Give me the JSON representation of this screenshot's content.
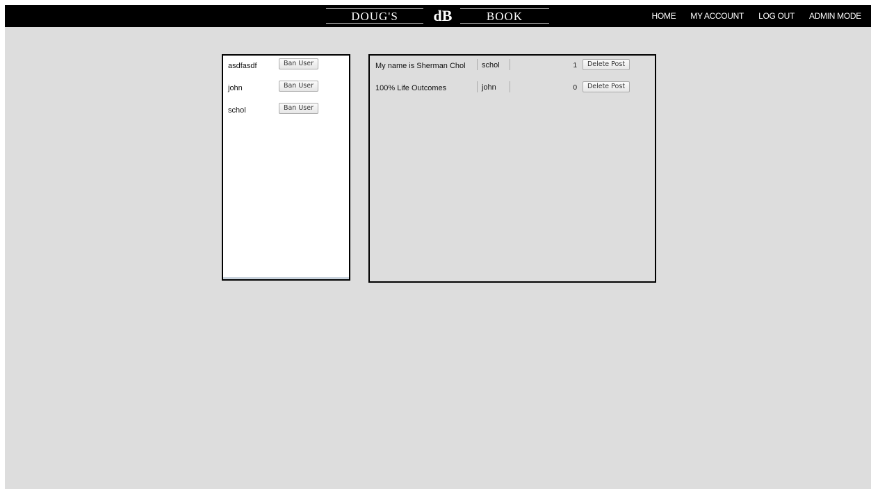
{
  "header": {
    "brand_left": "DOUG'S",
    "brand_logo": "dB",
    "brand_right": "BOOK",
    "nav": [
      {
        "label": "HOME"
      },
      {
        "label": "MY ACCOUNT"
      },
      {
        "label": "LOG OUT"
      },
      {
        "label": "ADMIN MODE"
      }
    ]
  },
  "users": [
    {
      "name": "asdfasdf",
      "action": "Ban User"
    },
    {
      "name": "john",
      "action": "Ban User"
    },
    {
      "name": "schol",
      "action": "Ban User"
    }
  ],
  "posts": [
    {
      "title": "My name is Sherman Chol",
      "author": "schol",
      "count": "1",
      "action": "Delete Post"
    },
    {
      "title": "100% Life Outcomes",
      "author": "john",
      "count": "0",
      "action": "Delete Post"
    }
  ],
  "colors": {
    "header_bg": "#000000",
    "page_bg": "#dddddd",
    "panel_border": "#000000"
  }
}
